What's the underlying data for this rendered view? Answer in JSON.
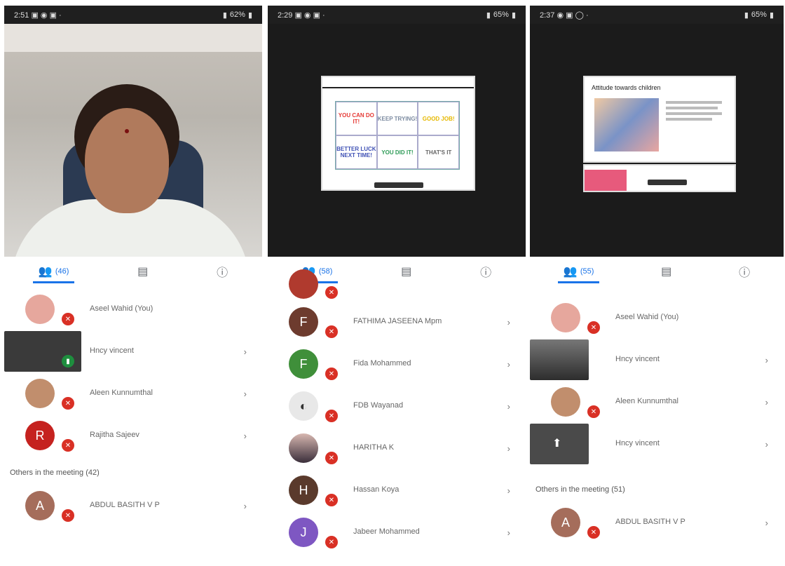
{
  "phones": [
    {
      "status": {
        "time": "2:51",
        "left_icons": "▣ ◉ ▣ ·",
        "battery": "62%"
      },
      "tabs": {
        "people": "(46)"
      },
      "rows": [
        {
          "name": "Aseel Wahid (You)",
          "avatar_color": "#e6a79d"
        },
        {
          "name": "Hncy vincent",
          "avatar_color": "#444"
        },
        {
          "name": "Aleen Kunnumthal",
          "avatar_color": "#c18e6d"
        },
        {
          "name": "Rajitha Sajeev",
          "initial": "R",
          "avatar_color": "#c5221f"
        }
      ],
      "section": "Others in the meeting (42)",
      "others": [
        {
          "name": "ABDUL BASITH V P",
          "initial": "A",
          "avatar_color": "#a56d5b"
        }
      ]
    },
    {
      "status": {
        "time": "2:29",
        "left_icons": "▣ ◉ ▣ ·",
        "battery": "65%"
      },
      "tabs": {
        "people": "(58)"
      },
      "slide": {
        "cells": [
          "YOU CAN DO IT!",
          "KEEP TRYING!",
          "GOOD JOB!",
          "BETTER LUCK NEXT TIME!",
          "YOU DID IT!",
          "THAT'S IT"
        ],
        "colors": [
          "#e53935",
          "#7b8aa0",
          "#e6b800",
          "#3f51b5",
          "#2e9b57",
          "#666666"
        ]
      },
      "rows": [
        {
          "name": "FATHIMA JASEENA Mpm",
          "initial": "F",
          "avatar_color": "#6d3b2e"
        },
        {
          "name": "Fida Mohammed",
          "initial": "F",
          "avatar_color": "#3f8f3a"
        },
        {
          "name": "FDB Wayanad",
          "avatar_color": "#e8e8e8"
        },
        {
          "name": "HARITHA K",
          "avatar_color": "#9a7a7a"
        },
        {
          "name": "Hassan Koya",
          "initial": "H",
          "avatar_color": "#5a3a2c"
        },
        {
          "name": "Jabeer Mohammed",
          "initial": "J",
          "avatar_color": "#7e57c2"
        }
      ]
    },
    {
      "status": {
        "time": "2:37",
        "left_icons": "◉ ▣ ◯ ·",
        "battery": "65%"
      },
      "tabs": {
        "people": "(55)"
      },
      "slide": {
        "title": "Attitude towards children"
      },
      "rows": [
        {
          "name": "Aseel Wahid (You)",
          "avatar_color": "#e6a79d"
        },
        {
          "name": "Hncy vincent",
          "avatar_color": "#555"
        },
        {
          "name": "Aleen Kunnumthal",
          "avatar_color": "#c18e6d"
        },
        {
          "name": "Hncy vincent",
          "avatar_color": "#444"
        }
      ],
      "section": "Others in the meeting (51)",
      "others": [
        {
          "name": "ABDUL BASITH V P",
          "initial": "A",
          "avatar_color": "#a56d5b"
        }
      ]
    }
  ]
}
